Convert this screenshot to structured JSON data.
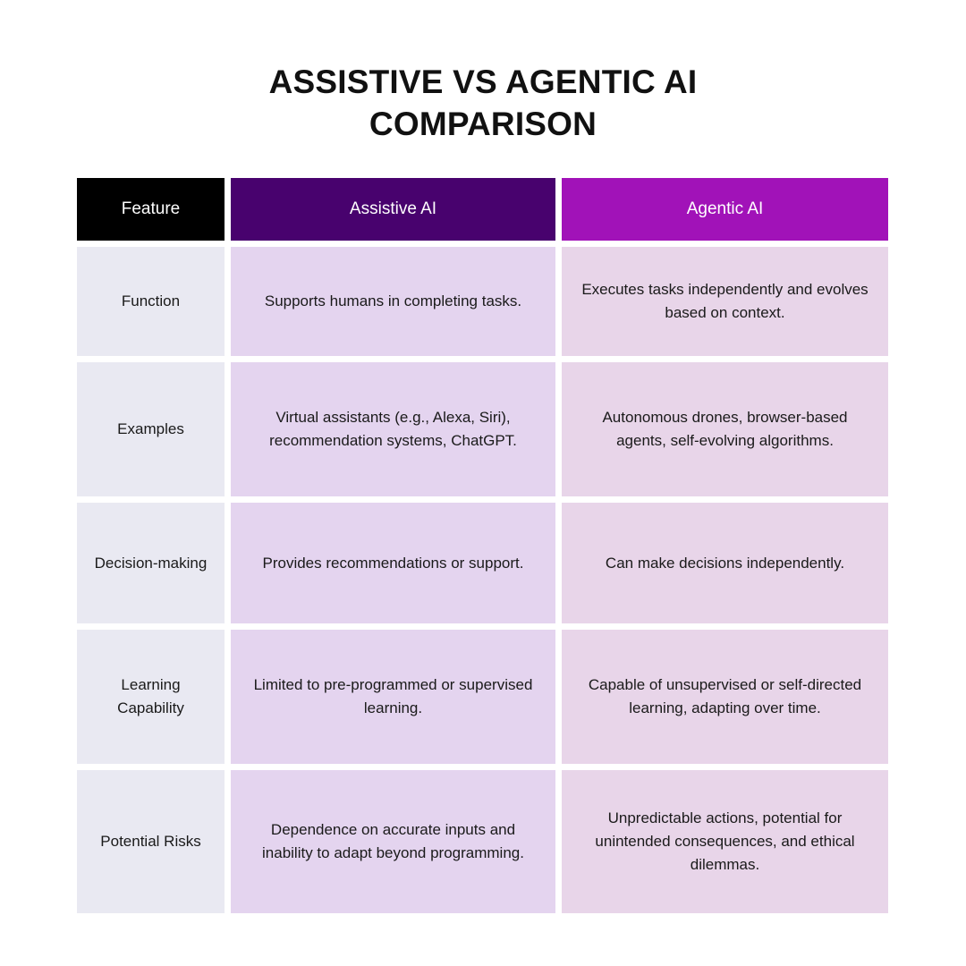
{
  "title": {
    "line1": "ASSISTIVE VS AGENTIC AI",
    "line2": "COMPARISON"
  },
  "colors": {
    "page_background": "#FFFFFF",
    "title_text": "#111111",
    "header_feature_bg": "#000000",
    "header_assistive_bg": "#48026E",
    "header_agentic_bg": "#A112B8",
    "header_text": "#FFFFFF",
    "cell_feature_bg": "#E9E9F2",
    "cell_assistive_bg": "#E4D4EF",
    "cell_agentic_bg": "#E8D5E9",
    "body_text": "#1A1A1A"
  },
  "table": {
    "headers": {
      "feature": "Feature",
      "assistive": "Assistive AI",
      "agentic": "Agentic AI"
    },
    "rows": [
      {
        "feature": "Function",
        "assistive": "Supports humans in completing tasks.",
        "agentic": "Executes tasks independently and evolves based on context."
      },
      {
        "feature": "Examples",
        "assistive": "Virtual assistants (e.g., Alexa, Siri), recommendation systems, ChatGPT.",
        "agentic": "Autonomous drones, browser-based agents, self-evolving algorithms."
      },
      {
        "feature": "Decision-making",
        "assistive": "Provides recommendations or support.",
        "agentic": "Can make decisions independently."
      },
      {
        "feature": "Learning Capability",
        "assistive": "Limited to pre-programmed or supervised learning.",
        "agentic": "Capable of unsupervised or self-directed learning, adapting over time."
      },
      {
        "feature": "Potential Risks",
        "assistive": "Dependence on accurate inputs and inability to adapt beyond programming.",
        "agentic": "Unpredictable actions, potential for unintended consequences, and ethical dilemmas."
      }
    ]
  }
}
